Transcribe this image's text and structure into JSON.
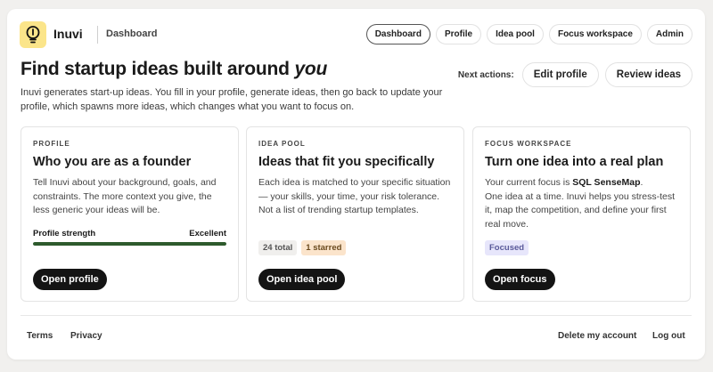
{
  "header": {
    "brand": "Inuvi",
    "current_page": "Dashboard",
    "logo_icon": "lightbulb-icon",
    "nav": [
      "Dashboard",
      "Profile",
      "Idea pool",
      "Focus workspace",
      "Admin"
    ],
    "active_nav": "Dashboard"
  },
  "hero": {
    "title_main": "Find startup ideas built around ",
    "title_emphasis": "you",
    "description": "Inuvi generates start-up ideas. You fill in your profile, generate ideas, then go back to update your profile, which spawns more ideas, which changes what you want to focus on."
  },
  "next_actions": {
    "label": "Next actions:",
    "edit_profile": "Edit profile",
    "review_ideas": "Review ideas"
  },
  "cards": {
    "profile": {
      "kicker": "PROFILE",
      "title": "Who you are as a founder",
      "description": "Tell Inuvi about your background, goals, and constraints. The more context you give, the less generic your ideas will be.",
      "strength_label": "Profile strength",
      "strength_value": "Excellent",
      "strength_fraction": 1.0,
      "button": "Open profile"
    },
    "idea_pool": {
      "kicker": "IDEA POOL",
      "title": "Ideas that fit you specifically",
      "description": "Each idea is matched to your specific situation — your skills, your time, your risk tolerance. Not a list of trending startup templates.",
      "total_tag": "24 total",
      "starred_tag": "1 starred",
      "button": "Open idea pool"
    },
    "focus": {
      "kicker": "FOCUS WORKSPACE",
      "title": "Turn one idea into a real plan",
      "current_prefix": "Your current focus is ",
      "current_focus": "SQL SenseMap",
      "current_suffix": ".",
      "description": "One idea at a time. Inuvi helps you stress-test it, map the competition, and define your first real move.",
      "status_tag": "Focused",
      "button": "Open focus"
    }
  },
  "footer": {
    "terms": "Terms",
    "privacy": "Privacy",
    "delete_account": "Delete my account",
    "logout": "Log out"
  },
  "colors": {
    "strength_bar": "#2d5a2c",
    "logo_bg": "#fbe58a",
    "button_bg": "#141414"
  }
}
